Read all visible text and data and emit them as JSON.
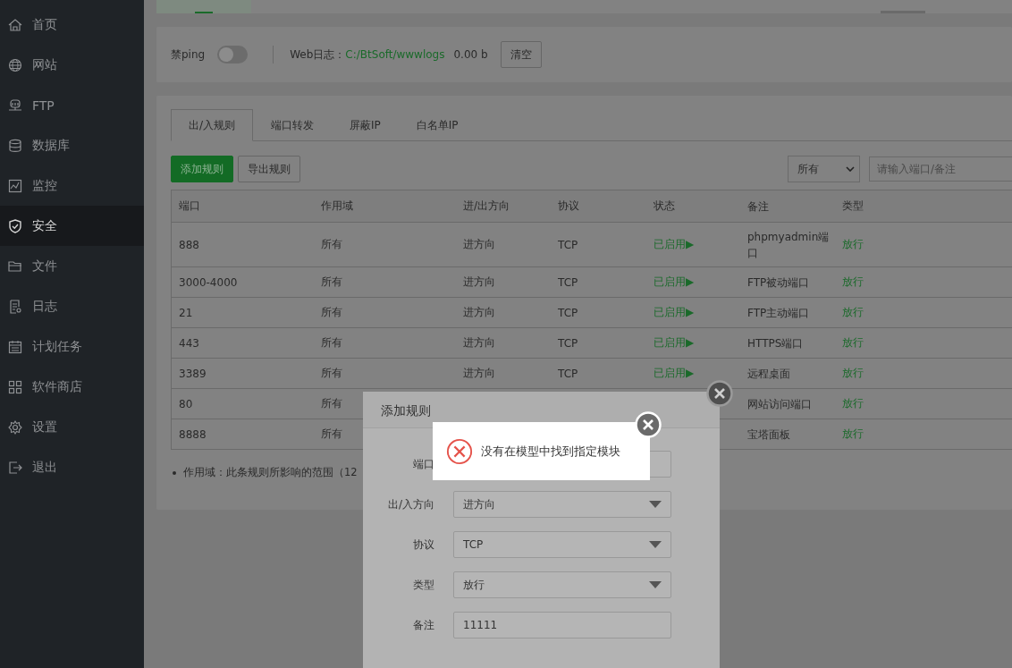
{
  "sidebar": {
    "items": [
      {
        "label": "首页",
        "selected": false
      },
      {
        "label": "网站",
        "selected": false
      },
      {
        "label": "FTP",
        "selected": false
      },
      {
        "label": "数据库",
        "selected": false
      },
      {
        "label": "监控",
        "selected": false
      },
      {
        "label": "安全",
        "selected": true
      },
      {
        "label": "文件",
        "selected": false
      },
      {
        "label": "日志",
        "selected": false
      },
      {
        "label": "计划任务",
        "selected": false
      },
      {
        "label": "软件商店",
        "selected": false
      },
      {
        "label": "设置",
        "selected": false
      },
      {
        "label": "退出",
        "selected": false
      }
    ]
  },
  "ping_bar": {
    "label": "禁ping",
    "toggle_on": false,
    "log_label": "Web日志：",
    "log_path": "C:/BtSoft/wwwlogs",
    "log_size": "0.00 b",
    "clear_button": "清空"
  },
  "tabs": [
    {
      "label": "出/入规则",
      "selected": true
    },
    {
      "label": "端口转发",
      "selected": false
    },
    {
      "label": "屏蔽IP",
      "selected": false
    },
    {
      "label": "白名单IP",
      "selected": false
    }
  ],
  "toolbar": {
    "add_button": "添加规则",
    "export_button": "导出规则",
    "filter": {
      "value": "所有"
    },
    "search": {
      "placeholder": "请输入端口/备注"
    }
  },
  "table": {
    "columns": [
      "端口",
      "作用域",
      "进/出方向",
      "协议",
      "状态",
      "备注",
      "类型"
    ],
    "rows": [
      {
        "port": "888",
        "scope": "所有",
        "direction": "进方向",
        "protocol": "TCP",
        "status": "已启用▶",
        "remark": "phpmyadmin端口",
        "type": "放行"
      },
      {
        "port": "3000-4000",
        "scope": "所有",
        "direction": "进方向",
        "protocol": "TCP",
        "status": "已启用▶",
        "remark": "FTP被动端口",
        "type": "放行"
      },
      {
        "port": "21",
        "scope": "所有",
        "direction": "进方向",
        "protocol": "TCP",
        "status": "已启用▶",
        "remark": "FTP主动端口",
        "type": "放行"
      },
      {
        "port": "443",
        "scope": "所有",
        "direction": "进方向",
        "protocol": "TCP",
        "status": "已启用▶",
        "remark": "HTTPS端口",
        "type": "放行"
      },
      {
        "port": "3389",
        "scope": "所有",
        "direction": "进方向",
        "protocol": "TCP",
        "status": "已启用▶",
        "remark": "远程桌面",
        "type": "放行"
      },
      {
        "port": "80",
        "scope": "所有",
        "remark": "网站访问端口",
        "type": "放行"
      },
      {
        "port": "8888",
        "scope": "所有",
        "remark": "宝塔面板",
        "type": "放行"
      }
    ]
  },
  "note": "作用域：此条规则所影响的范围（12",
  "dialog": {
    "title": "添加规则",
    "fields": [
      {
        "label": "端口",
        "kind": "input"
      },
      {
        "label": "出/入方向",
        "kind": "select",
        "value": "进方向"
      },
      {
        "label": "协议",
        "kind": "select",
        "value": "TCP"
      },
      {
        "label": "类型",
        "kind": "select",
        "value": "放行"
      },
      {
        "label": "备注",
        "kind": "input",
        "value": "11111"
      }
    ]
  },
  "toast": {
    "message": "没有在模型中找到指定模块"
  }
}
